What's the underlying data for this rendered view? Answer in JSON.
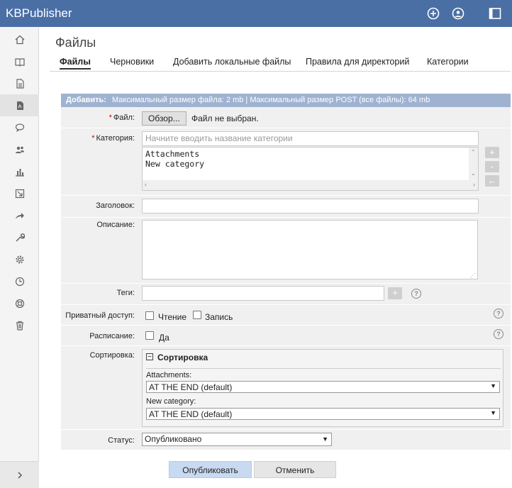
{
  "app": {
    "title": "KBPublisher"
  },
  "colors": {
    "topbar": "#4a6fa5",
    "form_header": "#9fb3d1",
    "publish_button": "#c8d9f2"
  },
  "header": {
    "icons": [
      "plus-circle-icon",
      "user-icon",
      "window-icon"
    ]
  },
  "sidebar": {
    "items": [
      {
        "icon": "home-icon"
      },
      {
        "icon": "book-icon"
      },
      {
        "icon": "document-icon"
      },
      {
        "icon": "file-icon",
        "active": true
      },
      {
        "icon": "chat-icon"
      },
      {
        "icon": "users-icon"
      },
      {
        "icon": "chart-icon"
      },
      {
        "icon": "export-icon"
      },
      {
        "icon": "share-icon"
      },
      {
        "icon": "wrench-icon"
      },
      {
        "icon": "gear-icon"
      },
      {
        "icon": "clock-icon"
      },
      {
        "icon": "lifebuoy-icon"
      },
      {
        "icon": "trash-icon"
      }
    ],
    "toggle": "›"
  },
  "page": {
    "title": "Файлы"
  },
  "tabs": [
    {
      "label": "Файлы",
      "active": true
    },
    {
      "label": "Черновики"
    },
    {
      "label": "Добавить локальные файлы"
    },
    {
      "label": "Правила для директорий"
    },
    {
      "label": "Категории"
    }
  ],
  "form": {
    "header_title": "Добавить:",
    "header_info": "Максимальный размер файла: 2 mb | Максимальный размер POST (все файлы): 64 mb",
    "file": {
      "label": "Файл:",
      "button": "Обзор...",
      "status": "Файл не выбран."
    },
    "category": {
      "label": "Категория:",
      "placeholder": "Начните вводить название категории",
      "list": [
        "Attachments",
        "New category"
      ],
      "buttons": [
        "+",
        "-",
        "←"
      ]
    },
    "title": {
      "label": "Заголовок:",
      "value": ""
    },
    "description": {
      "label": "Описание:",
      "value": ""
    },
    "tags": {
      "label": "Теги:",
      "value": "",
      "add_button": "+"
    },
    "private": {
      "label": "Приватный доступ:",
      "options": [
        "Чтение",
        "Запись"
      ]
    },
    "schedule": {
      "label": "Расписание:",
      "option": "Да"
    },
    "sort": {
      "label": "Сортировка:",
      "box_title": "Сортировка",
      "items": [
        {
          "name": "Attachments:",
          "value": "AT THE END (default)"
        },
        {
          "name": "New category:",
          "value": "AT THE END (default)"
        }
      ]
    },
    "status": {
      "label": "Статус:",
      "value": "Опубликовано"
    },
    "help": "?"
  },
  "actions": {
    "publish": "Опубликовать",
    "cancel": "Отменить"
  }
}
